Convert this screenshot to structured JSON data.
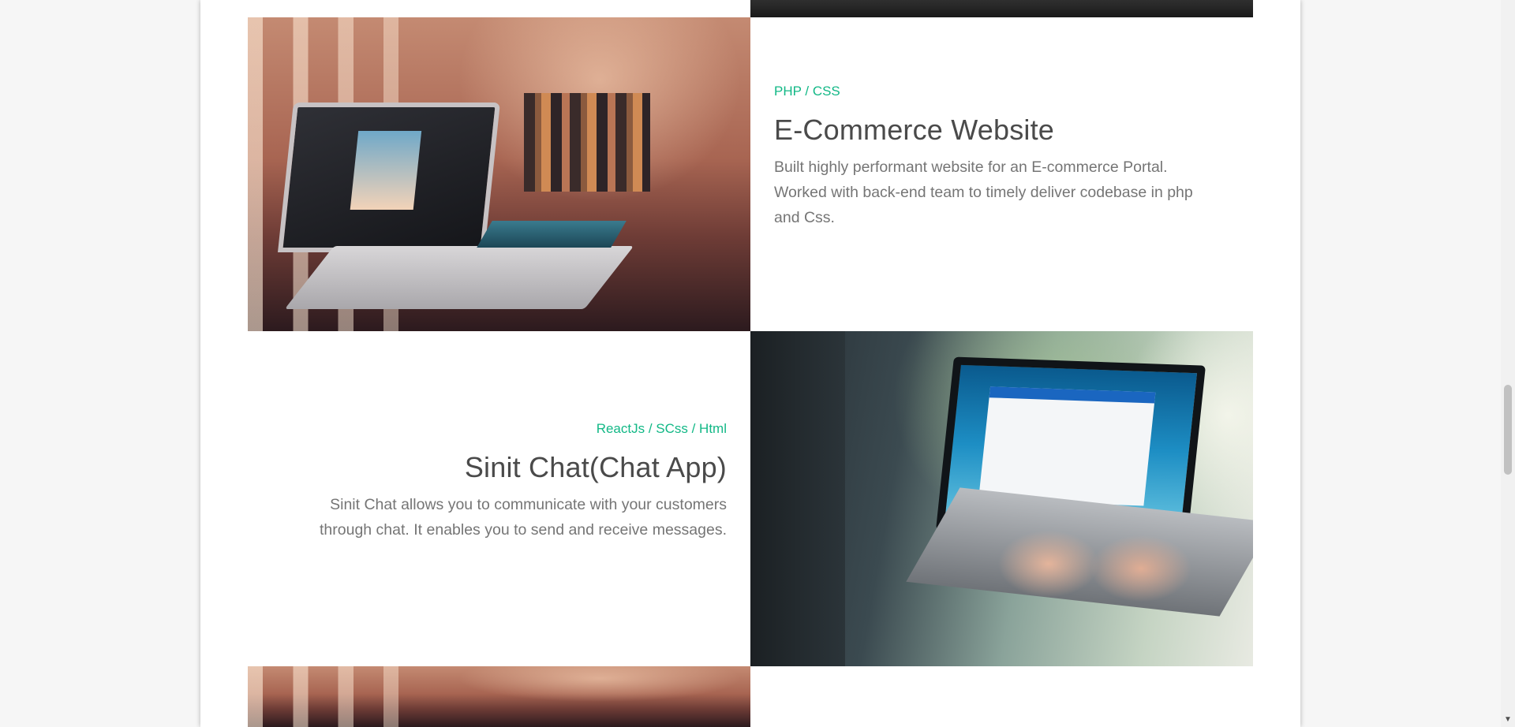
{
  "projects": [
    {
      "tags": "PHP / CSS",
      "title": "E-Commerce Website",
      "description": "Built highly performant website for an E-commerce Portal. Worked with back-end team to timely deliver codebase in php and Css."
    },
    {
      "tags": "ReactJs / SCss / Html",
      "title": "Sinit Chat(Chat App)",
      "description": "Sinit Chat allows you to communicate with your customers through chat. It enables you to send and receive messages."
    }
  ],
  "colors": {
    "accent": "#12b886",
    "title": "#4a4a4a",
    "body_text": "#757575",
    "page_background": "#f6f6f6"
  },
  "scrollbar": {
    "arrow_icon": "chevron-down-icon"
  }
}
